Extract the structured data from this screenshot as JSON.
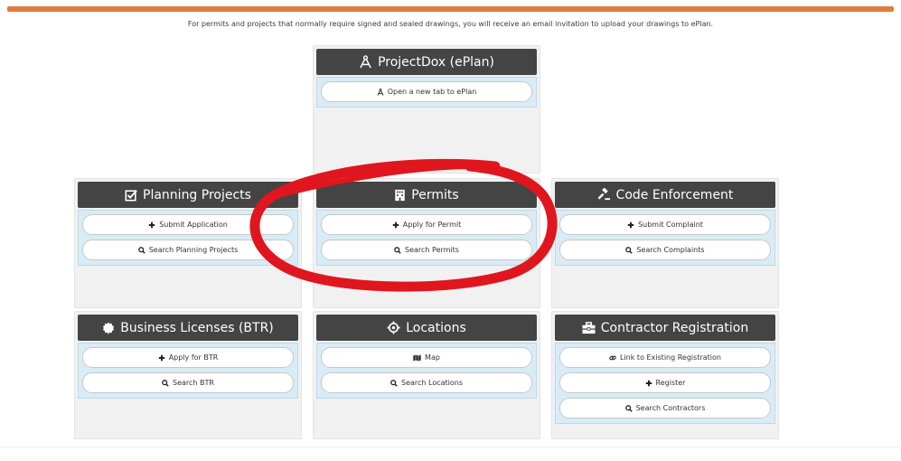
{
  "top_note": "For permits and projects that normally require signed and sealed drawings, you will receive an email invitation to upload your drawings to ePlan.",
  "colors": {
    "accent": "#e37a3f",
    "header_bg": "#444444",
    "panel_bg": "#d9ecf6",
    "annotation": "#e0161f"
  },
  "cards": {
    "projectdox": {
      "title": "ProjectDox (ePlan)",
      "icon": "compass-icon",
      "buttons": [
        {
          "label": "Open a new tab to ePlan",
          "icon": "compass-icon"
        }
      ]
    },
    "planning": {
      "title": "Planning Projects",
      "icon": "check-square-icon",
      "buttons": [
        {
          "label": "Submit Application",
          "icon": "plus-icon"
        },
        {
          "label": "Search Planning Projects",
          "icon": "search-icon"
        }
      ]
    },
    "permits": {
      "title": "Permits",
      "icon": "building-icon",
      "buttons": [
        {
          "label": "Apply for Permit",
          "icon": "plus-icon"
        },
        {
          "label": "Search Permits",
          "icon": "search-icon"
        }
      ]
    },
    "code": {
      "title": "Code Enforcement",
      "icon": "gavel-icon",
      "buttons": [
        {
          "label": "Submit Complaint",
          "icon": "plus-icon"
        },
        {
          "label": "Search Complaints",
          "icon": "search-icon"
        }
      ]
    },
    "business": {
      "title": "Business Licenses (BTR)",
      "icon": "certificate-icon",
      "buttons": [
        {
          "label": "Apply for BTR",
          "icon": "plus-icon"
        },
        {
          "label": "Search BTR",
          "icon": "search-icon"
        }
      ]
    },
    "locations": {
      "title": "Locations",
      "icon": "target-icon",
      "buttons": [
        {
          "label": "Map",
          "icon": "map-icon"
        },
        {
          "label": "Search Locations",
          "icon": "search-icon"
        }
      ]
    },
    "contractor": {
      "title": "Contractor Registration",
      "icon": "briefcase-icon",
      "buttons": [
        {
          "label": "Link to Existing Registration",
          "icon": "link-icon"
        },
        {
          "label": "Register",
          "icon": "plus-icon"
        },
        {
          "label": "Search Contractors",
          "icon": "search-icon"
        }
      ]
    }
  }
}
